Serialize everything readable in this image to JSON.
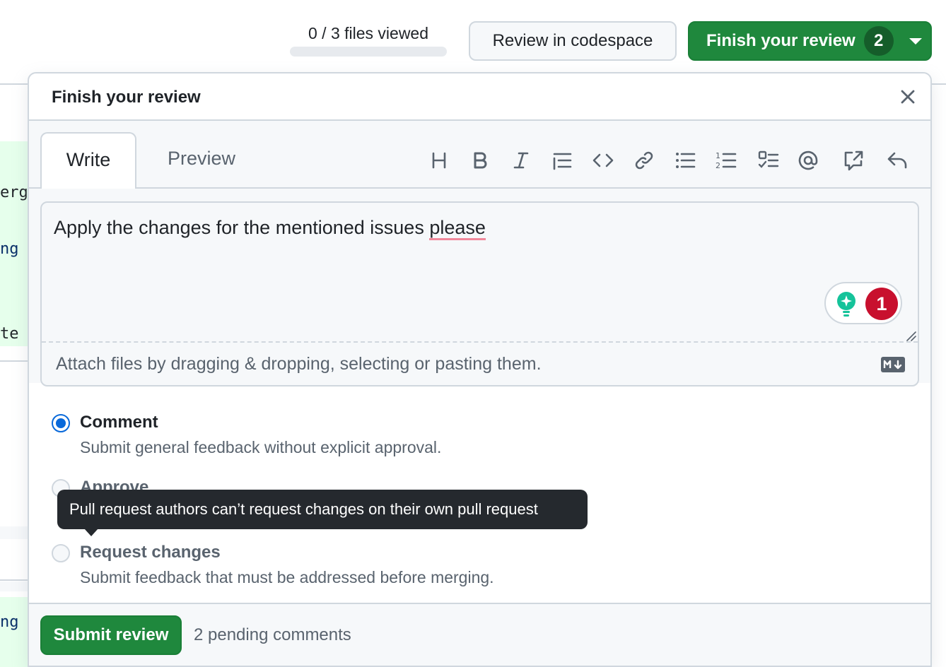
{
  "header": {
    "files_viewed": "0 / 3 files viewed",
    "files_viewed_fraction": 0,
    "review_codespace_label": "Review in codespace",
    "finish_review_label": "Finish your review",
    "finish_review_count": "2"
  },
  "background_diff": {
    "fragments": [
      "erg",
      "ng",
      "te",
      "ng"
    ]
  },
  "dialog": {
    "title": "Finish your review",
    "close_icon": "x-icon",
    "tabs": {
      "write": "Write",
      "preview": "Preview"
    },
    "toolbar": [
      {
        "name": "heading-icon"
      },
      {
        "name": "bold-icon"
      },
      {
        "name": "italic-icon"
      },
      {
        "name": "quote-icon"
      },
      {
        "name": "code-icon"
      },
      {
        "name": "link-icon"
      },
      {
        "name": "unordered-list-icon"
      },
      {
        "name": "ordered-list-icon"
      },
      {
        "name": "task-list-icon"
      },
      {
        "name": "mention-icon"
      },
      {
        "name": "cross-reference-icon"
      },
      {
        "name": "saved-reply-icon"
      }
    ],
    "editor": {
      "text_before": "Apply the changes for the mentioned issues ",
      "text_misspelled": "please",
      "grammarly_count": "1",
      "attach_hint": "Attach files by dragging & dropping, selecting or pasting them.",
      "markdown_icon": "markdown-icon"
    },
    "options": [
      {
        "id": "comment",
        "label": "Comment",
        "description": "Submit general feedback without explicit approval.",
        "checked": true,
        "disabled": false
      },
      {
        "id": "approve",
        "label": "Approve",
        "description": "",
        "checked": false,
        "disabled": true
      },
      {
        "id": "request_changes",
        "label": "Request changes",
        "description": "Submit feedback that must be addressed before merging.",
        "checked": false,
        "disabled": true
      }
    ],
    "tooltip": "Pull request authors can’t request changes on their own pull request",
    "footer": {
      "submit_label": "Submit review",
      "pending_comments": "2 pending comments"
    }
  },
  "colors": {
    "primary_green": "#1f883d",
    "accent_blue": "#0969da",
    "tooltip_bg": "#25292e",
    "grammarly_red": "#c8102e",
    "grammarly_green": "#15c39a"
  }
}
